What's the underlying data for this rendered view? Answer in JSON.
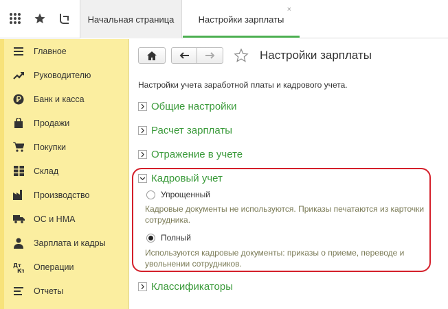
{
  "tabs": [
    {
      "label": "Начальная страница"
    },
    {
      "label": "Настройки зарплаты",
      "close": "×"
    }
  ],
  "sidebar": {
    "items": [
      {
        "label": "Главное",
        "icon": "menu-lines-icon"
      },
      {
        "label": "Руководителю",
        "icon": "trend-icon"
      },
      {
        "label": "Банк и касса",
        "icon": "ruble-coin-icon"
      },
      {
        "label": "Продажи",
        "icon": "shopping-bag-icon"
      },
      {
        "label": "Покупки",
        "icon": "cart-icon"
      },
      {
        "label": "Склад",
        "icon": "warehouse-grid-icon"
      },
      {
        "label": "Производство",
        "icon": "factory-icon"
      },
      {
        "label": "ОС и НМА",
        "icon": "truck-icon"
      },
      {
        "label": "Зарплата и кадры",
        "icon": "person-icon"
      },
      {
        "label": "Операции",
        "icon": "dt-kt-icon"
      },
      {
        "label": "Отчеты",
        "icon": "report-lines-icon"
      }
    ]
  },
  "page": {
    "title": "Настройки зарплаты",
    "description": "Настройки учета заработной платы и кадрового учета."
  },
  "sections": [
    {
      "label": "Общие настройки",
      "expanded": false
    },
    {
      "label": "Расчет зарплаты",
      "expanded": false
    },
    {
      "label": "Отражение в учете",
      "expanded": false
    },
    {
      "label": "Кадровый учет",
      "expanded": true
    },
    {
      "label": "Классификаторы",
      "expanded": false
    }
  ],
  "hr": {
    "options": [
      {
        "label": "Упрощенный",
        "selected": false,
        "hint": "Кадровые документы не используются. Приказы печатаются из карточки сотрудника."
      },
      {
        "label": "Полный",
        "selected": true,
        "hint": "Используются кадровые документы: приказы о приеме, переводе и увольнении сотрудников."
      }
    ]
  },
  "colors": {
    "sidebar_bg": "#fbeea0",
    "accent_green": "#3a9a3a",
    "highlight_red": "#d41f2a"
  }
}
